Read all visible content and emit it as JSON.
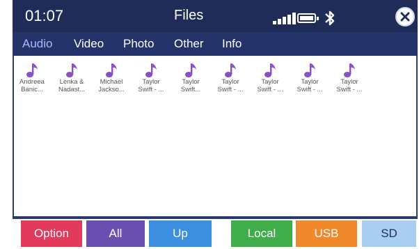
{
  "status": {
    "time": "01:07",
    "title": "Files"
  },
  "tabs": [
    {
      "label": "Audio",
      "active": true
    },
    {
      "label": "Video"
    },
    {
      "label": "Photo"
    },
    {
      "label": "Other"
    },
    {
      "label": "Info"
    }
  ],
  "files": [
    {
      "line1": "Andreea",
      "line2": "Banic..."
    },
    {
      "line1": "Lenka &",
      "line2": "Nadast..."
    },
    {
      "line1": "Michael",
      "line2": "Jackso..."
    },
    {
      "line1": "Taylor",
      "line2": "Swift - ..."
    },
    {
      "line1": "Taylor",
      "line2": "Swift..."
    },
    {
      "line1": "Taylor",
      "line2": "Swift - ..."
    },
    {
      "line1": "Taylor",
      "line2": "Swift - ..."
    },
    {
      "line1": "Taylor",
      "line2": "Swift - ..."
    },
    {
      "line1": "Taylor",
      "line2": "Swift - ..."
    }
  ],
  "buttons": [
    {
      "label": "Option",
      "color": "#e23a5a"
    },
    {
      "label": "All",
      "color": "#6b4fb0"
    },
    {
      "label": "Up",
      "color": "#3d8fe0"
    },
    {
      "label": "Local",
      "color": "#3fae4a"
    },
    {
      "label": "USB",
      "color": "#f0892c"
    },
    {
      "label": "SD",
      "color": "#a9cff0"
    }
  ],
  "colors": {
    "screen_bg": "#2a3b6e",
    "active_tab": "#a9b8ff",
    "music_note": "#8b4fc4"
  },
  "icons": [
    "signal-icon",
    "battery-icon",
    "bluetooth-icon",
    "close-icon",
    "music-note-icon"
  ]
}
